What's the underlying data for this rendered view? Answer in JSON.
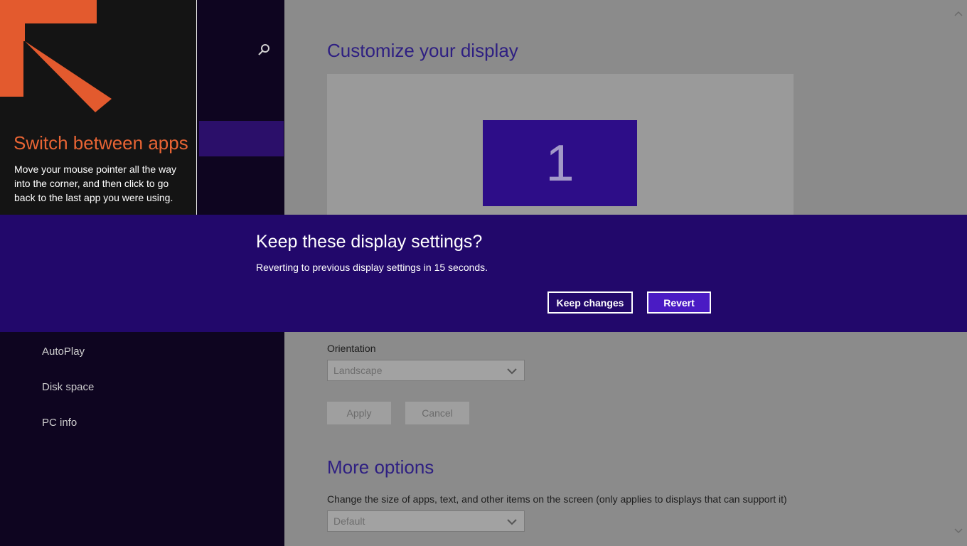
{
  "nav": {
    "items": [
      {
        "label": "AutoPlay"
      },
      {
        "label": "Disk space"
      },
      {
        "label": "PC info"
      }
    ],
    "icons": {
      "search": "search-icon"
    }
  },
  "main": {
    "title": "Customize your display",
    "monitor_label": "1",
    "orientation": {
      "label": "Orientation",
      "value": "Landscape"
    },
    "apply_label": "Apply",
    "cancel_label": "Cancel",
    "more_options": {
      "title": "More options",
      "size_label": "Change the size of apps, text, and other items on the screen (only applies to displays that can support it)",
      "size_value": "Default"
    }
  },
  "tip": {
    "title": "Switch between apps",
    "text": "Move your mouse pointer all the way into the corner, and then click to go back to the last app you were using."
  },
  "dialog": {
    "title": "Keep these display settings?",
    "message": "Reverting to previous display settings in 15 seconds.",
    "keep_label": "Keep changes",
    "revert_label": "Revert"
  },
  "colors": {
    "accent": "#22086b",
    "revert_button": "#4a1bc4",
    "tip_title": "#e86434"
  }
}
